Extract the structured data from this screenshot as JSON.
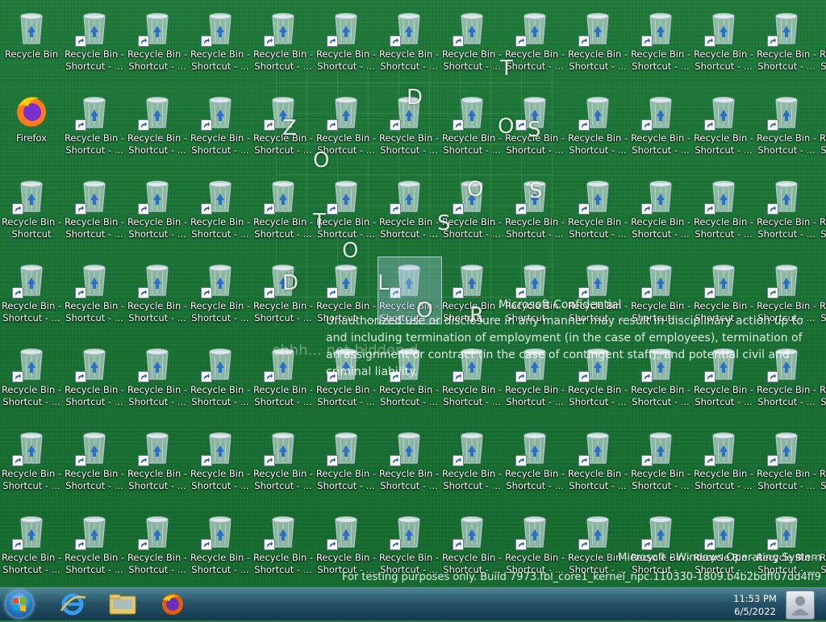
{
  "desktop": {
    "icons": {
      "recycle_bin": "Recycle Bin",
      "firefox": "Firefox",
      "shortcut_line1": "Recycle Bin -",
      "shortcut_line2_ellipsis": "Shortcut - ...",
      "shortcut_line2_plain": "Shortcut"
    },
    "overlay": {
      "letters": [
        "T",
        "D",
        "Z",
        "O",
        "O",
        "S",
        "O",
        "S",
        "T",
        "S",
        "O",
        "D",
        "L",
        "O",
        "R"
      ],
      "faded_text": "shhh... not hidden d",
      "confidential_title": "Microsoft Confidential",
      "confidential_body": "Unauthorized use or disclosure in any manner may result in disciplinary action up to and including termination of employment (in the case of employees), termination of an assignment or contract (in the case of contingent staff), and potential civil and criminal liability.",
      "watermark_line1": "Microsoft - Windows Operating System",
      "watermark_line2": "For testing purposes only. Build 7973.fbl_core1_kernel_npc.110330-1809.b4b2bdff07dd4ff9"
    }
  },
  "taskbar": {
    "time": "11:53 PM",
    "date": "6/5/2022",
    "pinned": [
      "internet-explorer",
      "windows-explorer",
      "firefox"
    ]
  },
  "colors": {
    "desktop_bg": "#1a7134",
    "taskbar": "#2a5a7a"
  }
}
